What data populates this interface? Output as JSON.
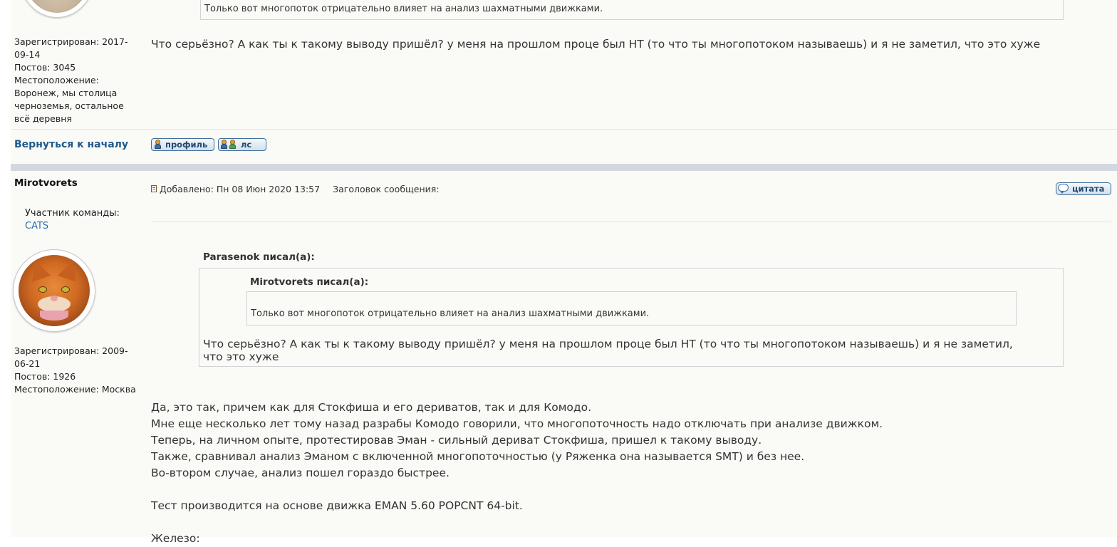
{
  "prev_post": {
    "quote_text": "Только вот многопоток отрицательно влияет на анализ шахматными движками.",
    "profile": {
      "registered_label": "Зарегистрирован: 2017-",
      "registered_cont": "09-14",
      "posts": "Постов: 3045",
      "location_label": "Местоположение:",
      "location_lines": [
        "Воронеж, мы столица",
        "черноземья, остальное",
        "всё деревня"
      ]
    },
    "message": "Что серьёзно? А как ты к такому выводу пришёл? у меня на прошлом проце был НТ (то что ты многопотоком называешь) и я не заметил, что это хуже",
    "back_to_top": "Вернуться к началу",
    "profile_button": "профиль",
    "pm_button": "лс"
  },
  "post": {
    "author": "Mirotvorets",
    "team_label": "Участник команды:",
    "team_name": "CATS",
    "posted": "Добавлено: Пн 08 Июн 2020 13:57",
    "subject_label": "Заголовок сообщения:",
    "quote_button": "цитата",
    "registered_label": "Зарегистрирован: 2009-",
    "registered_cont": "06-21",
    "posts": "Постов: 1926",
    "location": "Местоположение: Москва",
    "outer_quote": {
      "author": "Parasenok писал(а):",
      "inner_author": "Mirotvorets писал(а):",
      "inner_text": "Только вот многопоток отрицательно влияет на анализ шахматными движками.",
      "text_line1": "Что серьёзно? А как ты к такому выводу пришёл? у меня на прошлом проце был НТ (то что ты многопотоком называешь) и я не заметил,",
      "text_line2": "что это хуже"
    },
    "body_lines": [
      "Да, это так, причем как для Стокфиша и его дериватов, так и для Комодо.",
      "Мне еще несколько лет тому назад разрабы Комодо говорили, что многопоточность надо отключать при анализе движком.",
      "Теперь, на личном опыте, протестировав Эман - сильный дериват Стокфиша, пришел к такому выводу.",
      "Также, сравнивал анализ Эманом с включенной многопоточностью (у Ряженка она называется SMT) и без нее.",
      "Во-втором случае, анализ пошел гораздо быстрее."
    ],
    "test_line": "Тест производится на основе движка EMAN 5.60 POPCNT 64-bit.",
    "cut_line": "Железо:"
  },
  "colors": {
    "link": "#1f5a8a",
    "divider": "#d3d8e0",
    "button_border": "#3d6f9c"
  }
}
